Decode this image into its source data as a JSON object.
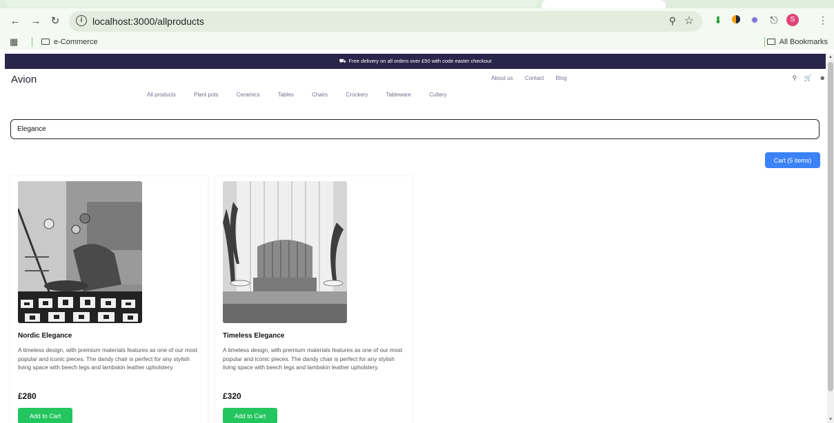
{
  "browser": {
    "url": "localhost:3000/allproducts",
    "bookmarks": [
      "e-Commerce",
      "All Bookmarks"
    ],
    "profile_initial": "S"
  },
  "page": {
    "promo": "Free delivery on all orders over £50 with code easter checkout",
    "brand": "Avion",
    "top_links": [
      "About us",
      "Contact",
      "Blog"
    ],
    "categories": [
      "All products",
      "Plant pots",
      "Ceramics",
      "Tables",
      "Chairs",
      "Crockery",
      "Tableware",
      "Cultery"
    ],
    "search": {
      "value": "Elegance"
    },
    "cart_label": "Cart (5 items)",
    "products": [
      {
        "name": "Nordic Elegance",
        "description": "A timeless design, with premium materials features as one of our most popular and iconic pieces. The dandy chair is perfect for any stylish living space with beech legs and lambskin leather upholstery.",
        "price": "£280",
        "button": "Add to Cart"
      },
      {
        "name": "Timeless Elegance",
        "description": "A timeless design, with premium materials features as one of our most popular and iconic pieces. The dandy chair is perfect for any stylish living space with beech legs and lambskin leather upholstery.",
        "price": "£320",
        "button": "Add to Cart"
      }
    ]
  },
  "colors": {
    "promo_bg": "#2a254b",
    "cart_button": "#3b82f6",
    "add_button": "#22c55e"
  },
  "icons": [
    "back-icon",
    "forward-icon",
    "reload-icon",
    "info-icon",
    "zoom-icon",
    "star-icon",
    "search-icon",
    "cart-icon",
    "user-icon",
    "truck-icon"
  ]
}
